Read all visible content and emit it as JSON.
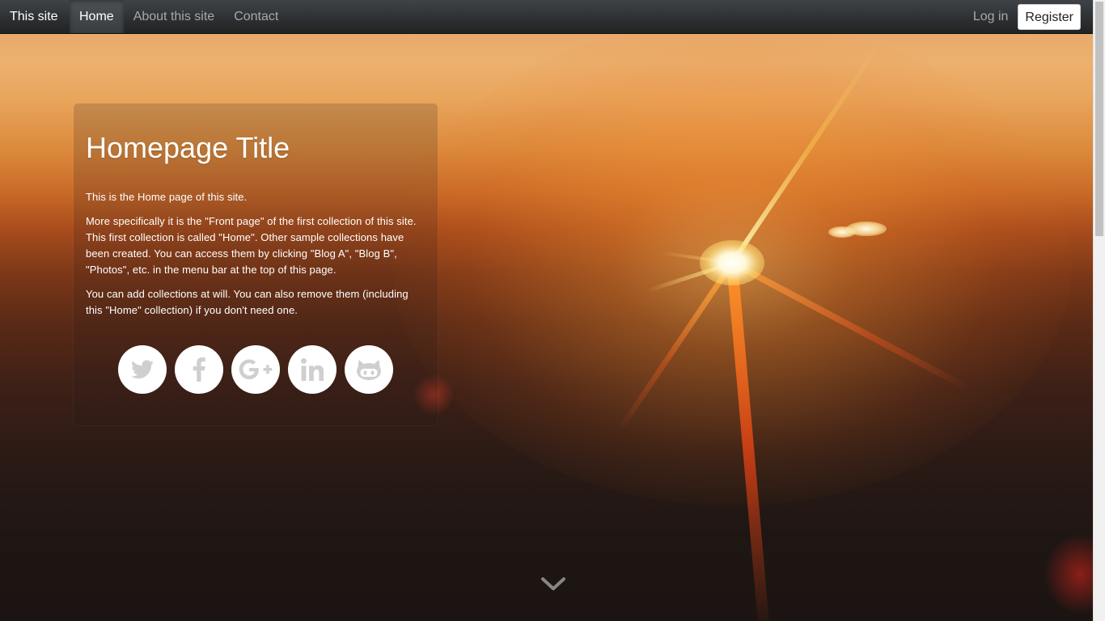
{
  "navbar": {
    "brand": "This site",
    "links": [
      {
        "label": "Home",
        "active": true
      },
      {
        "label": "About this site",
        "active": false
      },
      {
        "label": "Contact",
        "active": false
      }
    ],
    "login_label": "Log in",
    "register_label": "Register"
  },
  "intro": {
    "title": "Homepage Title",
    "paragraphs": [
      "This is the Home page of this site.",
      "More specifically it is the \"Front page\" of the first collection of this site. This first collection is called \"Home\". Other sample collections have been created. You can access them by clicking \"Blog A\", \"Blog B\", \"Photos\", etc. in the menu bar at the top of this page.",
      "You can add collections at will. You can also remove them (including this \"Home\" collection) if you don't need one."
    ]
  },
  "social_links": [
    {
      "icon": "twitter-icon"
    },
    {
      "icon": "facebook-icon"
    },
    {
      "icon": "google-plus-icon"
    },
    {
      "icon": "linkedin-icon"
    },
    {
      "icon": "github-icon"
    }
  ],
  "scroll_down_icon": "chevron-down-icon",
  "colors": {
    "navbar_bg": "#2c2f32",
    "nav_active_text": "#ffffff",
    "nav_text": "#a8a8a8",
    "social_circle": "#ffffff",
    "social_icon": "#cfcfcf"
  }
}
